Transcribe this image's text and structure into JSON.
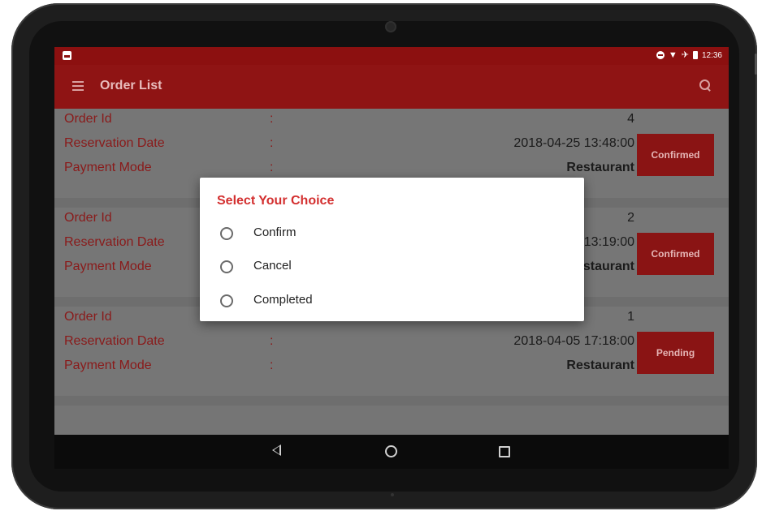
{
  "status_bar": {
    "time": "12:36",
    "icons": [
      "image-notification-icon",
      "do-not-disturb-icon",
      "wifi-icon",
      "airplane-icon",
      "battery-icon"
    ]
  },
  "app_bar": {
    "title": "Order List",
    "menu_icon": "hamburger-menu-icon",
    "search_icon": "search-icon"
  },
  "colors": {
    "primary": "#b71c1c",
    "accent_title": "#d32f2f",
    "dim_overlay": "rgba(0,0,0,0.55)"
  },
  "orders": [
    {
      "order_id_label": "Order Id",
      "date_label": "Reservation Date",
      "payment_label": "Payment Mode",
      "colon": ":",
      "order_id": "4",
      "reservation_date": "2018-04-25 13:48:00",
      "payment_mode": "Restaurant",
      "status": "Confirmed"
    },
    {
      "order_id_label": "Order Id",
      "date_label": "Reservation Date",
      "payment_label": "Payment Mode",
      "colon": ":",
      "order_id": "2",
      "reservation_date": "2018-04-05 13:19:00",
      "payment_mode": "Restaurant",
      "status": "Confirmed"
    },
    {
      "order_id_label": "Order Id",
      "date_label": "Reservation Date",
      "payment_label": "Payment Mode",
      "colon": ":",
      "order_id": "1",
      "reservation_date": "2018-04-05 17:18:00",
      "payment_mode": "Restaurant",
      "status": "Pending"
    }
  ],
  "dialog": {
    "title": "Select Your Choice",
    "options": [
      {
        "label": "Confirm",
        "selected": false
      },
      {
        "label": "Cancel",
        "selected": false
      },
      {
        "label": "Completed",
        "selected": false
      }
    ]
  },
  "nav_bar": {
    "buttons": [
      "back-icon",
      "home-icon",
      "recent-apps-icon"
    ]
  }
}
